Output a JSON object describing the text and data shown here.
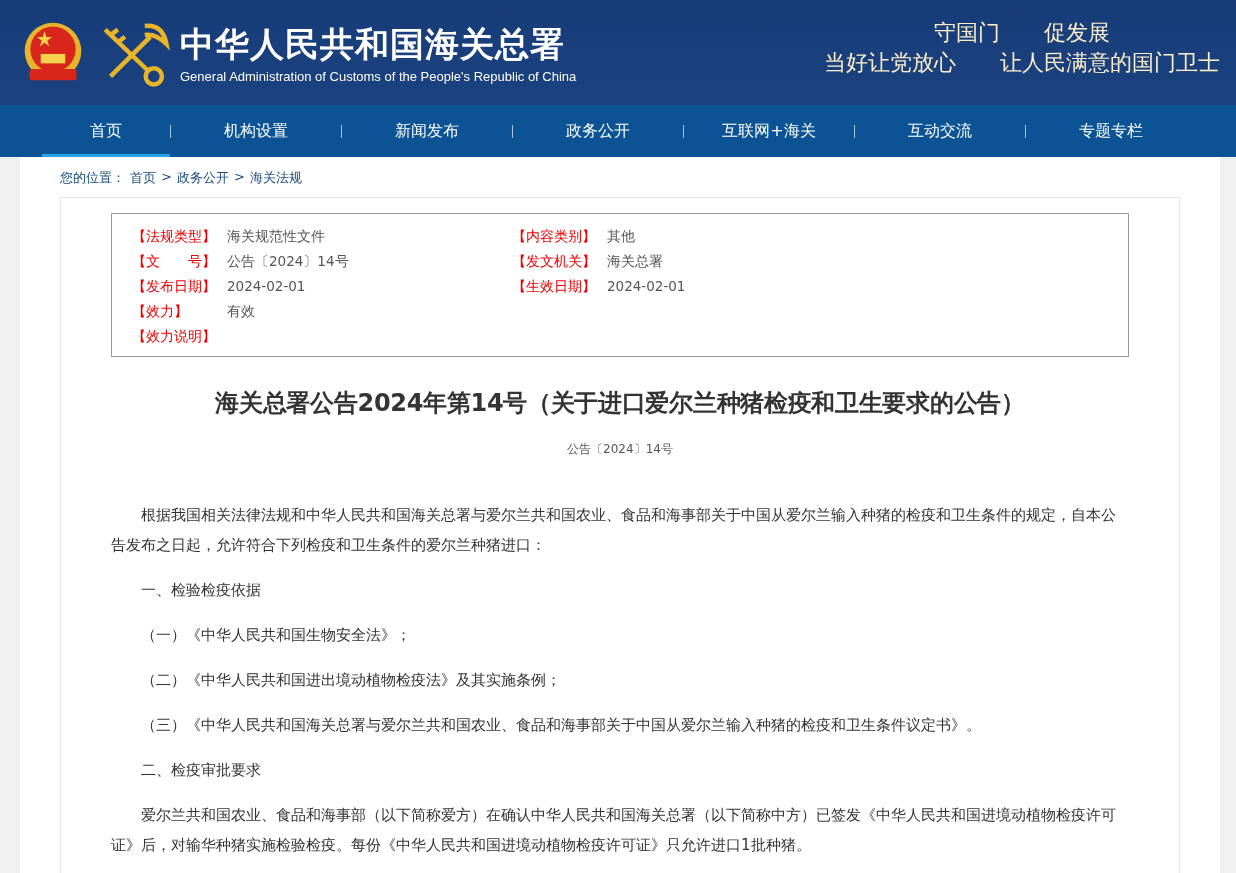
{
  "header": {
    "title": "中华人民共和国海关总署",
    "subtitle": "General Administration of Customs of the People's Republic of China",
    "slogans": [
      "守国门　　促发展",
      "当好让党放心　　让人民满意的国门卫士"
    ]
  },
  "nav": [
    {
      "label": "首页",
      "selected": true
    },
    {
      "label": "机构设置",
      "selected": false
    },
    {
      "label": "新闻发布",
      "selected": false
    },
    {
      "label": "政务公开",
      "selected": false
    },
    {
      "label": "互联网+海关",
      "selected": false
    },
    {
      "label": "互动交流",
      "selected": false
    },
    {
      "label": "专题专栏",
      "selected": false
    }
  ],
  "breadcrumb": {
    "label": "您的位置：",
    "separator": ">",
    "items": [
      "首页",
      "政务公开",
      "海关法规"
    ]
  },
  "meta": [
    [
      {
        "label": "【法规类型】",
        "value": "海关规范性文件"
      },
      {
        "label": "【内容类别】",
        "value": "其他"
      }
    ],
    [
      {
        "label": "【文　　号】",
        "value": "公告〔2024〕14号"
      },
      {
        "label": "【发文机关】",
        "value": "海关总署"
      }
    ],
    [
      {
        "label": "【发布日期】",
        "value": "2024-02-01"
      },
      {
        "label": "【生效日期】",
        "value": "2024-02-01"
      }
    ],
    [
      {
        "label": "【效力】",
        "value": "有效"
      }
    ],
    [
      {
        "label": "【效力说明】"
      }
    ]
  ],
  "article": {
    "title": "海关总署公告2024年第14号（关于进口爱尔兰种猪检疫和卫生要求的公告）",
    "doc_number": "公告〔2024〕14号",
    "paragraphs": [
      "根据我国相关法律法规和中华人民共和国海关总署与爱尔兰共和国农业、食品和海事部关于中国从爱尔兰输入种猪的检疫和卫生条件的规定，自本公告发布之日起，允许符合下列检疫和卫生条件的爱尔兰种猪进口：",
      "一、检验检疫依据",
      "（一）《中华人民共和国生物安全法》；",
      "（二）《中华人民共和国进出境动植物检疫法》及其实施条例；",
      "（三）《中华人民共和国海关总署与爱尔兰共和国农业、食品和海事部关于中国从爱尔兰输入种猪的检疫和卫生条件议定书》。",
      "二、检疫审批要求",
      "爱尔兰共和国农业、食品和海事部（以下简称爱方）在确认中华人民共和国海关总署（以下简称中方）已签发《中华人民共和国进境动植物检疫许可证》后，对输华种猪实施检验检疫。每份《中华人民共和国进境动植物检疫许可证》只允许进口1批种猪。"
    ]
  }
}
